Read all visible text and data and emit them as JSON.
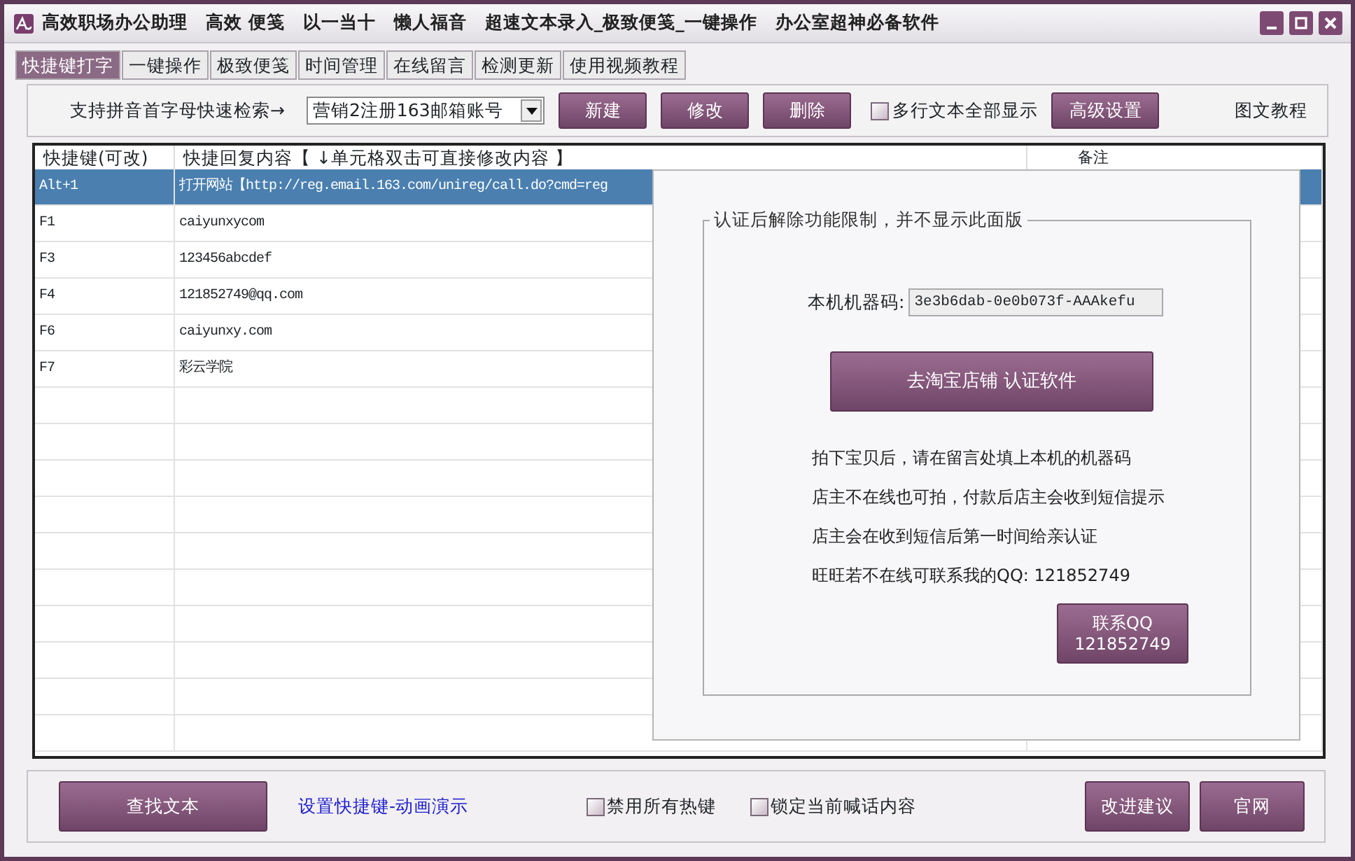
{
  "window": {
    "title": "高效职场办公助理　高效 便笺　以一当十　懒人福音　超速文本录入_极致便笺_一键操作　办公室超神必备软件"
  },
  "tabs": [
    {
      "label": "快捷键打字",
      "selected": true
    },
    {
      "label": "一键操作",
      "selected": false
    },
    {
      "label": "极致便笺",
      "selected": false
    },
    {
      "label": "时间管理",
      "selected": false
    },
    {
      "label": "在线留言",
      "selected": false
    },
    {
      "label": "检测更新",
      "selected": false
    },
    {
      "label": "使用视频教程",
      "selected": false
    }
  ],
  "toolbar": {
    "search_label": "支持拼音首字母快速检索→",
    "dropdown_value": "营销2注册163邮箱账号",
    "buttons": [
      "新建",
      "修改",
      "删除"
    ],
    "multiline_checkbox": {
      "label": "多行文本全部显示",
      "checked": false
    },
    "advanced_button": "高级设置",
    "tutorial_link": "图文教程"
  },
  "table": {
    "columns": [
      "快捷键(可改)",
      "快捷回复内容【 ↓单元格双击可直接修改内容 】",
      "备注"
    ],
    "rows": [
      {
        "key": "Alt+1",
        "content": "打开网站【http://reg.email.163.com/unireg/call.do?cmd=reg",
        "selected": true
      },
      {
        "key": "F1",
        "content": "caiyunxycom",
        "selected": false
      },
      {
        "key": "F3",
        "content": "123456abcdef",
        "selected": false
      },
      {
        "key": "F4",
        "content": "121852749@qq.com",
        "selected": false
      },
      {
        "key": "F6",
        "content": "caiyunxy.com",
        "selected": false
      },
      {
        "key": "F7",
        "content": "彩云学院",
        "selected": false
      }
    ]
  },
  "activation_panel": {
    "group_title": "认证后解除功能限制，并不显示此面版",
    "machine_code_label": "本机机器码:",
    "machine_code": "3e3b6dab-0e0b073f-AAAkefu",
    "shop_button": "去淘宝店铺 认证软件",
    "notes": [
      "拍下宝贝后，请在留言处填上本机的机器码",
      "店主不在线也可拍，付款后店主会收到短信提示",
      "店主会在收到短信后第一时间给亲认证",
      "旺旺若不在线可联系我的QQ: 121852749"
    ],
    "contact_button": [
      "联系QQ",
      "121852749"
    ]
  },
  "bottom_bar": {
    "find_button": "查找文本",
    "demo_link": "设置快捷键-动画演示",
    "checkboxes": [
      {
        "label": "禁用所有热键",
        "checked": false
      },
      {
        "label": "锁定当前喊话内容",
        "checked": false
      }
    ],
    "buttons": [
      "改进建议",
      "官网"
    ]
  }
}
